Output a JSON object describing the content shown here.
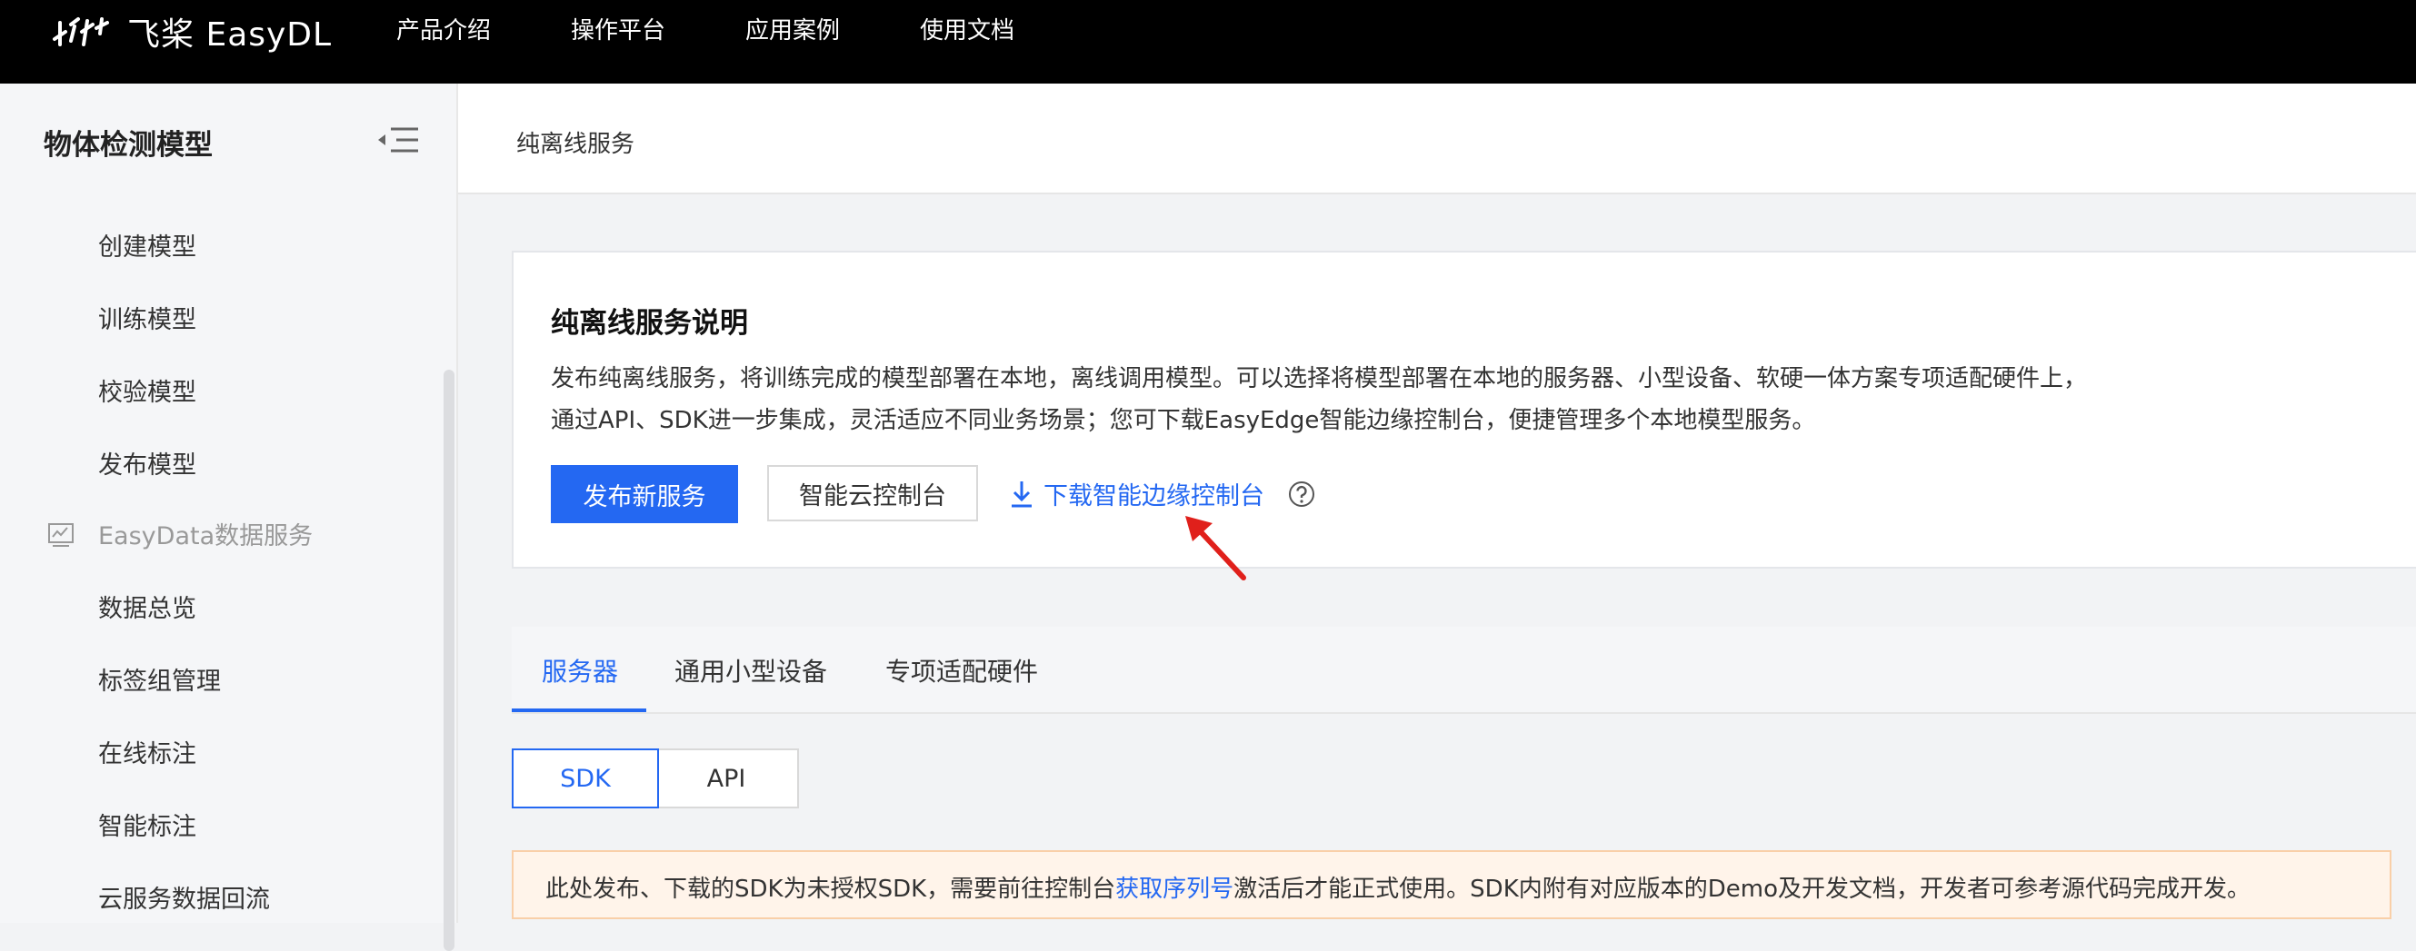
{
  "topbar": {
    "logo_text": "飞桨 EasyDL",
    "nav": [
      "产品介绍",
      "操作平台",
      "应用案例",
      "使用文档"
    ]
  },
  "sidebar": {
    "title": "物体检测模型",
    "items_group1": [
      "创建模型",
      "训练模型",
      "校验模型",
      "发布模型"
    ],
    "section": "EasyData数据服务",
    "items_group2": [
      "数据总览",
      "标签组管理",
      "在线标注",
      "智能标注",
      "云服务数据回流"
    ]
  },
  "breadcrumb": "纯离线服务",
  "card": {
    "title": "纯离线服务说明",
    "desc_line1": "发布纯离线服务，将训练完成的模型部署在本地，离线调用模型。可以选择将模型部署在本地的服务器、小型设备、软硬一体方案专项适配硬件上，",
    "desc_line2": "通过API、SDK进一步集成，灵活适应不同业务场景；您可下载EasyEdge智能边缘控制台，便捷管理多个本地模型服务。",
    "btn_publish": "发布新服务",
    "btn_console": "智能云控制台",
    "download_link": "下载智能边缘控制台"
  },
  "tabs": [
    "服务器",
    "通用小型设备",
    "专项适配硬件"
  ],
  "segments": [
    "SDK",
    "API"
  ],
  "notice": {
    "prefix": "此处发布、下载的SDK为未授权SDK，需要前往控制台",
    "link": "获取序列号",
    "suffix": "激活后才能正式使用。SDK内附有对应版本的Demo及开发文档，开发者可参考源代码完成开发。"
  },
  "colors": {
    "primary": "#2468f2",
    "topbar": "#000000",
    "notice_bg": "#fff4ea",
    "arrow": "#e0201b"
  }
}
